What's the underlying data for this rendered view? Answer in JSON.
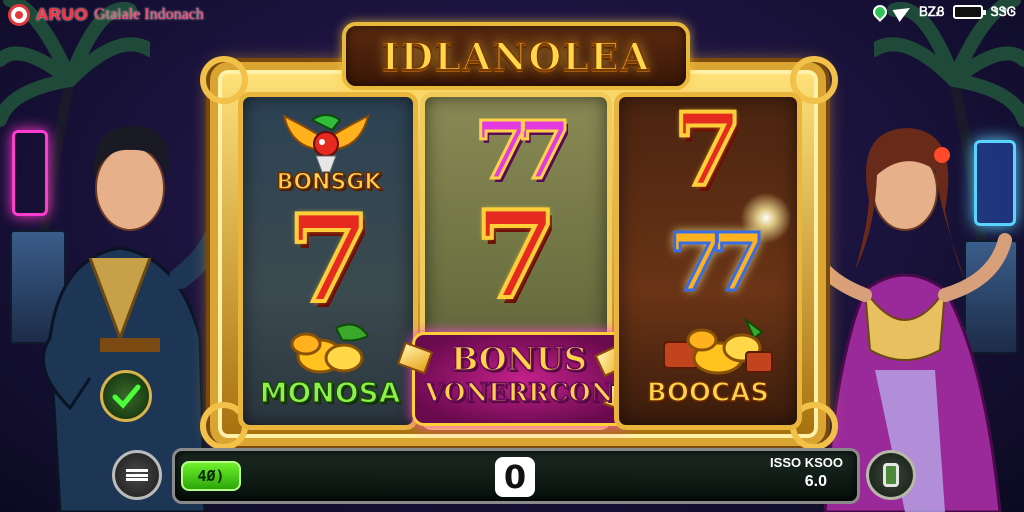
{
  "status_bar": {
    "app_name": "ARUO",
    "app_subtitle": "Gtaiale Indonach",
    "network_text": "ᏴᏃᏰ",
    "clock": "ᏕᏕᎶ",
    "icons": [
      "location-pin-icon",
      "send-icon",
      "battery-icon"
    ]
  },
  "game": {
    "title": "IDLANOLEA",
    "reels": [
      {
        "symbols": [
          {
            "icon": "bird-icon",
            "label": "BONSGK"
          },
          {
            "label": "7"
          },
          {
            "icon": "gold-coins-icon",
            "label": "MONOSA"
          }
        ]
      },
      {
        "symbols": [
          {
            "label": "77"
          },
          {
            "label": "7"
          },
          {
            "icon": "gems-icon",
            "label_line1": "BONUS",
            "label_line2": "VONERRCON"
          }
        ]
      },
      {
        "symbols": [
          {
            "label": "7"
          },
          {
            "label": "77"
          },
          {
            "icon": "treasure-coins-icon",
            "label": "BOOCAS"
          }
        ]
      }
    ]
  },
  "controls": {
    "balance": "4Ø)",
    "win_value": "0",
    "bet_label": "ISSO KSOO",
    "bet_value": "6.0",
    "menu_icon": "grille-menu-icon",
    "spin_icon": "canister-spin-icon",
    "check_icon": "checkmark-icon"
  },
  "colors": {
    "frame_gold": "#d9a431",
    "title_yellow": "#ffd84a",
    "seven_red": "#e52b1f",
    "seven_pink": "#e23ae0",
    "balance_green": "#6ef02a",
    "brand_red": "#ff2e3e"
  }
}
